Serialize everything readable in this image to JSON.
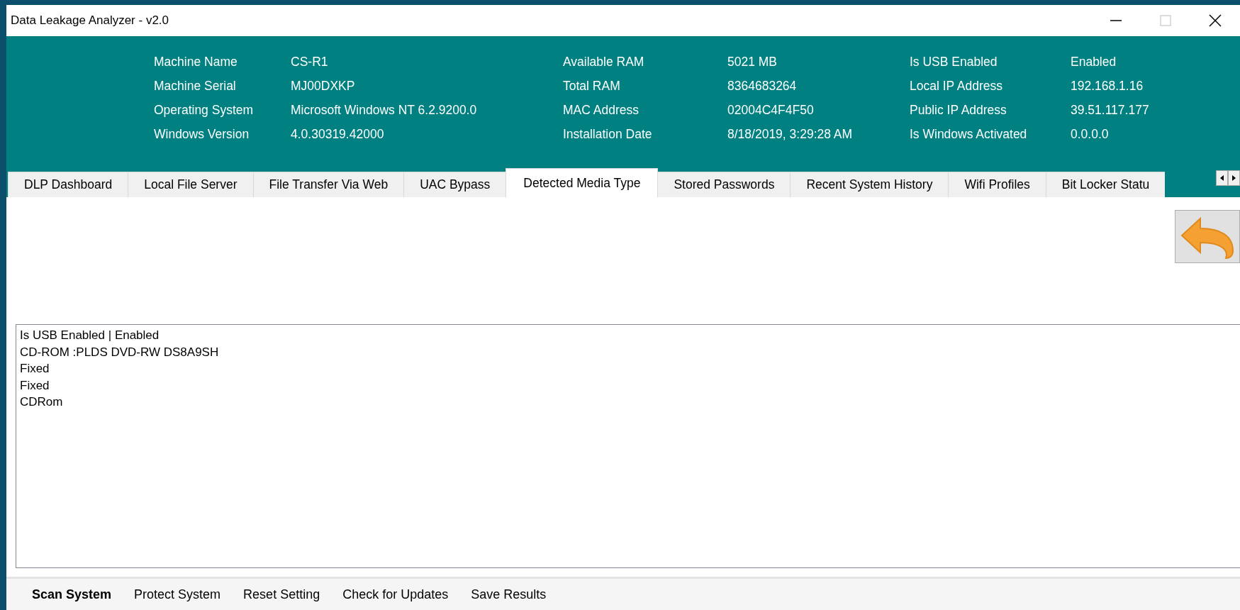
{
  "window": {
    "title": "Data Leakage Analyzer - v2.0"
  },
  "system_info": [
    {
      "label": "Machine Name",
      "value": "CS-R1"
    },
    {
      "label": "Available RAM",
      "value": "5021 MB"
    },
    {
      "label": "Is USB Enabled",
      "value": "Enabled"
    },
    {
      "label": "Machine Serial",
      "value": "MJ00DXKP"
    },
    {
      "label": "Total RAM",
      "value": "8364683264"
    },
    {
      "label": "Local IP Address",
      "value": "192.168.1.16"
    },
    {
      "label": "Operating System",
      "value": "Microsoft Windows NT 6.2.9200.0"
    },
    {
      "label": "MAC Address",
      "value": "02004C4F4F50"
    },
    {
      "label": "Public IP Address",
      "value": "39.51.117.177"
    },
    {
      "label": "Windows Version",
      "value": "4.0.30319.42000"
    },
    {
      "label": "Installation Date",
      "value": "8/18/2019, 3:29:28 AM"
    },
    {
      "label": "Is Windows Activated",
      "value": "0.0.0.0"
    }
  ],
  "tabs": [
    {
      "label": "DLP Dashboard",
      "selected": false
    },
    {
      "label": "Local File Server",
      "selected": false
    },
    {
      "label": "File Transfer Via Web",
      "selected": false
    },
    {
      "label": "UAC Bypass",
      "selected": false
    },
    {
      "label": "Detected Media Type",
      "selected": true
    },
    {
      "label": "Stored Passwords",
      "selected": false
    },
    {
      "label": "Recent System History",
      "selected": false
    },
    {
      "label": "Wifi Profiles",
      "selected": false
    },
    {
      "label": "Bit Locker Statu",
      "selected": false
    }
  ],
  "results": [
    "Is USB Enabled | Enabled",
    "CD-ROM :PLDS DVD-RW DS8A9SH",
    "Fixed",
    "Fixed",
    "CDRom"
  ],
  "menu": [
    {
      "label": "Scan System",
      "selected": true
    },
    {
      "label": "Protect System",
      "selected": false
    },
    {
      "label": "Reset Setting",
      "selected": false
    },
    {
      "label": "Check for Updates",
      "selected": false
    },
    {
      "label": "Save Results",
      "selected": false
    }
  ]
}
